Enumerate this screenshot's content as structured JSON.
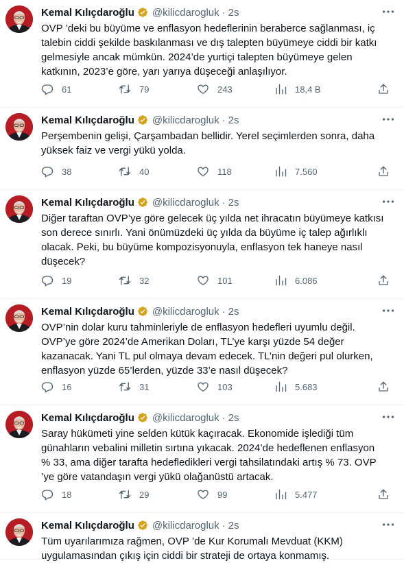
{
  "icons": {
    "verified": "verified-badge-icon",
    "more": "more-options-icon",
    "reply": "reply-icon",
    "retweet": "retweet-icon",
    "like": "like-icon",
    "views": "views-icon",
    "share": "share-icon"
  },
  "colors": {
    "verified_gold": "#d4a21b",
    "muted": "#536471",
    "text": "#0f1419"
  },
  "tweets": [
    {
      "name": "Kemal Kılıçdaroğlu",
      "handle": "@kilicdarogluk",
      "dot": "·",
      "time": "2s",
      "text": "OVP ’deki bu büyüme ve enflasyon hedeflerinin beraberce sağlanması, iç\ntalebin ciddi şekilde baskılanması ve dış talepten büyümeye ciddi bir katkı\ngelmesiyle ancak mümkün. 2024’de yurtiçi talepten büyümeye gelen\nkatkının, 2023’e göre, yarı yarıya düşeceği anlaşılıyor.",
      "replies": "61",
      "retweets": "79",
      "likes": "243",
      "views": "18,4 B"
    },
    {
      "name": "Kemal Kılıçdaroğlu",
      "handle": "@kilicdarogluk",
      "dot": "·",
      "time": "2s",
      "text": "Perşembenin gelişi, Çarşambadan bellidir. Yerel seçimlerden sonra, daha\nyüksek faiz ve vergi yükü yolda.",
      "replies": "38",
      "retweets": "40",
      "likes": "118",
      "views": "7.560"
    },
    {
      "name": "Kemal Kılıçdaroğlu",
      "handle": "@kilicdarogluk",
      "dot": "·",
      "time": "2s",
      "text": "Diğer taraftan OVP’ye göre gelecek üç yılda net ihracatın büyümeye katkısı\nson derece sınırlı. Yani önümüzdeki üç yılda da büyüme iç talep ağırlıklı\nolacak. Peki, bu büyüme kompozisyonuyla, enflasyon tek haneye nasıl\ndüşecek?",
      "replies": "19",
      "retweets": "32",
      "likes": "101",
      "views": "6.086"
    },
    {
      "name": "Kemal Kılıçdaroğlu",
      "handle": "@kilicdarogluk",
      "dot": "·",
      "time": "2s",
      "text": "OVP’nin dolar kuru tahminleriyle de enflasyon hedefleri uyumlu değil.\nOVP’ye göre 2024’de Amerikan Doları, TL’ye karşı yüzde 54 değer\nkazanacak. Yani TL pul olmaya devam edecek. TL’nin değeri pul olurken,\nenflasyon yüzde 65’lerden, yüzde 33’e nasıl düşecek?",
      "replies": "16",
      "retweets": "31",
      "likes": "103",
      "views": "5.683"
    },
    {
      "name": "Kemal Kılıçdaroğlu",
      "handle": "@kilicdarogluk",
      "dot": "·",
      "time": "2s",
      "text": "Saray hükümeti yine selden kütük kaçıracak. Ekonomide işlediği tüm\ngünahların vebalini milletin sırtına yıkacak. 2024’de hedeflenen enflasyon\n% 33, ama diğer tarafta hedefledikleri vergi tahsilatındaki artış % 73. OVP\n’ye göre vatandaşın vergi yükü olağanüstü artacak.",
      "replies": "18",
      "retweets": "29",
      "likes": "99",
      "views": "5.477"
    },
    {
      "name": "Kemal Kılıçdaroğlu",
      "handle": "@kilicdarogluk",
      "dot": "·",
      "time": "2s",
      "text": "Tüm uyarılarımıza rağmen, OVP ’de Kur Korumalı Mevduat (KKM)\nuygulamasından çıkış için ciddi bir strateji de ortaya konmamış."
    }
  ]
}
